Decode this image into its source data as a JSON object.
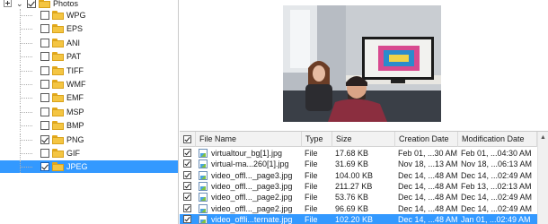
{
  "tree": {
    "root": {
      "label": "Photos",
      "checked": true
    },
    "items": [
      {
        "label": "WPG",
        "checked": false
      },
      {
        "label": "EPS",
        "checked": false
      },
      {
        "label": "ANI",
        "checked": false
      },
      {
        "label": "PAT",
        "checked": false
      },
      {
        "label": "TIFF",
        "checked": false
      },
      {
        "label": "WMF",
        "checked": false
      },
      {
        "label": "EMF",
        "checked": false
      },
      {
        "label": "MSP",
        "checked": false
      },
      {
        "label": "BMP",
        "checked": false
      },
      {
        "label": "PNG",
        "checked": true
      },
      {
        "label": "GIF",
        "checked": false
      },
      {
        "label": "JPEG",
        "checked": true,
        "selected": true
      }
    ]
  },
  "table": {
    "columns": {
      "name": "File Name",
      "type": "Type",
      "size": "Size",
      "created": "Creation Date",
      "modified": "Modification Date"
    },
    "rows": [
      {
        "name": "virtualtour_bg[1].jpg",
        "type": "File",
        "size": "17.68 KB",
        "created": "Feb 01, ...30 AM",
        "modified": "Feb 01, ...04:30 AM",
        "checked": true
      },
      {
        "name": "virtual-ma...260[1].jpg",
        "type": "File",
        "size": "31.69 KB",
        "created": "Nov 18, ...13 AM",
        "modified": "Nov 18, ...06:13 AM",
        "checked": true
      },
      {
        "name": "video_offl..._page3.jpg",
        "type": "File",
        "size": "104.00 KB",
        "created": "Dec 14, ...48 AM",
        "modified": "Dec 14, ...02:49 AM",
        "checked": true
      },
      {
        "name": "video_offl..._page3.jpg",
        "type": "File",
        "size": "211.27 KB",
        "created": "Dec 14, ...48 AM",
        "modified": "Feb 13, ...02:13 AM",
        "checked": true
      },
      {
        "name": "video_offl..._page2.jpg",
        "type": "File",
        "size": "53.76 KB",
        "created": "Dec 14, ...48 AM",
        "modified": "Dec 14, ...02:49 AM",
        "checked": true
      },
      {
        "name": "video_offl..._page2.jpg",
        "type": "File",
        "size": "96.69 KB",
        "created": "Dec 14, ...48 AM",
        "modified": "Dec 14, ...02:49 AM",
        "checked": true
      },
      {
        "name": "video_offli...ternate.jpg",
        "type": "File",
        "size": "102.20 KB",
        "created": "Dec 14, ...48 AM",
        "modified": "Jan 01, ...02:49 AM",
        "checked": true,
        "selected": true
      }
    ]
  },
  "colors": {
    "selection": "#3399ff",
    "folder": "#f4c542"
  },
  "icons": {
    "expander": "collapse-toggle-icon",
    "chevron": "chevron-down-icon",
    "folder": "folder-icon",
    "file": "image-file-icon",
    "scroll_up": "scroll-up-arrow-icon"
  }
}
